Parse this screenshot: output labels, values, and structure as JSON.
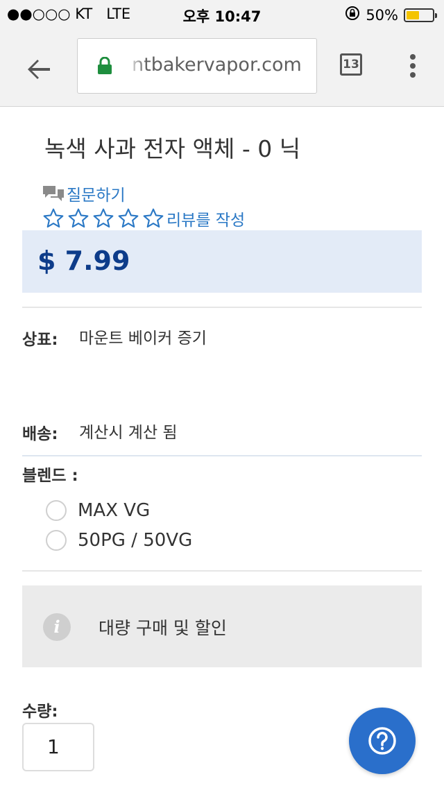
{
  "status_bar": {
    "carrier": "●●○○○ KT",
    "network": "LTE",
    "time": "오후 10:47",
    "battery_percent": "50%",
    "battery_level": 0.5,
    "battery_color": "#f4c400"
  },
  "browser": {
    "url": "ntbakervapor.com",
    "tab_count": "13",
    "back_icon": "back-arrow-icon",
    "lock_icon": "lock-icon",
    "menu_icon": "overflow-menu-icon",
    "accent_lock_color": "#1e8e3e"
  },
  "product": {
    "title": "녹색 사과 전자 액체 - 0 닉",
    "ask_question": "질문하기",
    "write_review": "리뷰를 작성",
    "rating_stars": 0,
    "rating_max": 5,
    "price": "$ 7.99",
    "price_color": "#0d3c8a",
    "link_color": "#2a78c5"
  },
  "details": {
    "brand_label": "상표:",
    "brand_value": "마운트 베이커 증기",
    "shipping_label": "배송:",
    "shipping_value": "계산시 계산 됨",
    "blend_label": "블렌드 :",
    "blend_options": [
      "MAX VG",
      "50PG / 50VG"
    ]
  },
  "bulk": {
    "text": "대량 구매 및 할인",
    "icon": "info-icon"
  },
  "quantity": {
    "label": "수량:",
    "value": "1"
  },
  "help": {
    "icon": "question-mark-icon",
    "color": "#2a6fcb"
  }
}
